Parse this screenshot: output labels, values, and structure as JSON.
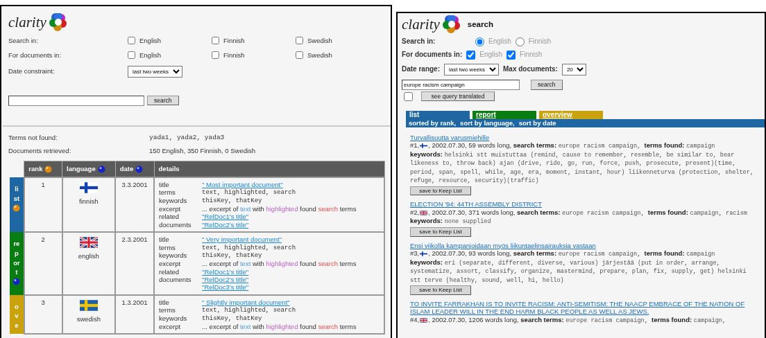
{
  "left": {
    "logo": "clarity",
    "search_in": {
      "label": "Search in:",
      "options": [
        {
          "label": "English",
          "checked": false
        },
        {
          "label": "Finnish",
          "checked": false
        },
        {
          "label": "Swedish",
          "checked": false
        }
      ]
    },
    "for_documents_in": {
      "label": "For documents in:",
      "options": [
        {
          "label": "English",
          "checked": false
        },
        {
          "label": "Finnish",
          "checked": false
        },
        {
          "label": "Swedish",
          "checked": false
        }
      ]
    },
    "date_constraint": {
      "label": "Date constraint:",
      "value": "last two weeks"
    },
    "search_button": "search",
    "terms_not_found": {
      "label": "Terms not found:",
      "value": "yada1, yada2, yada3"
    },
    "documents_retrieved": {
      "label": "Documents retrieved:",
      "value": "150 English, 350 Finnish, 0 Swedish"
    },
    "side_tabs": [
      {
        "label": "list",
        "color": "#1f67a3",
        "sortable": true,
        "selected": true
      },
      {
        "label": "report",
        "color": "#0a7d12",
        "sortable": true,
        "selected": false
      },
      {
        "label": "ove",
        "color": "#c9a20e",
        "sortable": false
      }
    ],
    "table": {
      "columns": [
        {
          "label": "rank",
          "sortable": true,
          "selected": true
        },
        {
          "label": "language",
          "sortable": true,
          "selected": false
        },
        {
          "label": "date",
          "sortable": true,
          "selected": false
        },
        {
          "label": "details",
          "sortable": false
        }
      ],
      "rows": [
        {
          "rank": "1",
          "kind": "fi",
          "language": "finnish",
          "date": "3.3.2001",
          "fields": [
            {
              "label": "title",
              "kind": "link",
              "values": [
                "\" Most important document\""
              ]
            },
            {
              "label": "terms",
              "kind": "mono",
              "values": [
                "text, highlighted, search"
              ]
            },
            {
              "label": "keywords",
              "kind": "mono",
              "values": [
                "thisKey, thatKey"
              ]
            },
            {
              "label": "excerpt",
              "kind": "excerpt",
              "segments": [
                {
                  "text": "... excerpt of ",
                  "kind": "plain"
                },
                {
                  "text": "text",
                  "kind": "term"
                },
                {
                  "text": " with ",
                  "kind": "plain"
                },
                {
                  "text": "highlighted",
                  "kind": "highlight"
                },
                {
                  "text": " found ",
                  "kind": "plain"
                },
                {
                  "text": "search",
                  "kind": "match"
                },
                {
                  "text": " terms",
                  "kind": "plain"
                }
              ]
            },
            {
              "label": "related documents",
              "kind": "link",
              "values": [
                "\"RelDoc1's title\"",
                "\"RelDoc2's title\""
              ]
            }
          ]
        },
        {
          "rank": "2",
          "kind": "gb",
          "language": "english",
          "date": "2.3.2001",
          "fields": [
            {
              "label": "title",
              "kind": "link",
              "values": [
                "\" Very important document\""
              ]
            },
            {
              "label": "terms",
              "kind": "mono",
              "values": [
                "text, highlighted, search"
              ]
            },
            {
              "label": "keywords",
              "kind": "mono",
              "values": [
                "thisKey, thatKey"
              ]
            },
            {
              "label": "excerpt",
              "kind": "excerpt",
              "segments": [
                {
                  "text": "... excerpt of ",
                  "kind": "plain"
                },
                {
                  "text": "text",
                  "kind": "term"
                },
                {
                  "text": " with ",
                  "kind": "plain"
                },
                {
                  "text": "highlighted",
                  "kind": "highlight"
                },
                {
                  "text": " found ",
                  "kind": "plain"
                },
                {
                  "text": "search",
                  "kind": "match"
                },
                {
                  "text": " terms",
                  "kind": "plain"
                }
              ]
            },
            {
              "label": "related documents",
              "kind": "link",
              "values": [
                "\"RelDoc1's title\"",
                "\"RelDoc2's title\"",
                "\"RelDoc3's title\""
              ]
            }
          ]
        },
        {
          "rank": "3",
          "kind": "se",
          "language": "swedish",
          "date": "1.3.2001",
          "fields": [
            {
              "label": "title",
              "kind": "link",
              "values": [
                "\" Slightly important document\""
              ]
            },
            {
              "label": "terms",
              "kind": "mono",
              "values": [
                "text, highlighted, search"
              ]
            },
            {
              "label": "keywords",
              "kind": "mono",
              "values": [
                "thisKey, thatKey"
              ]
            },
            {
              "label": "excerpt",
              "kind": "excerpt",
              "segments": [
                {
                  "text": "... excerpt of ",
                  "kind": "plain"
                },
                {
                  "text": "text",
                  "kind": "term"
                },
                {
                  "text": " with ",
                  "kind": "plain"
                },
                {
                  "text": "highlighted",
                  "kind": "highlight"
                },
                {
                  "text": " found ",
                  "kind": "plain"
                },
                {
                  "text": "search",
                  "kind": "match"
                },
                {
                  "text": " terms",
                  "kind": "plain"
                }
              ]
            }
          ]
        }
      ]
    }
  },
  "right": {
    "logo": "clarity",
    "heading": "search",
    "search_in": {
      "label": "Search in:",
      "options": [
        {
          "label": "English",
          "selected": true
        },
        {
          "label": "Finnish",
          "selected": false
        }
      ]
    },
    "for_documents_in": {
      "label": "For documents in:",
      "options": [
        {
          "label": "English",
          "checked": true
        },
        {
          "label": "Finnish",
          "checked": true
        }
      ]
    },
    "date_range": {
      "label": "Date range:",
      "value": "last two weeks"
    },
    "max_documents": {
      "label": "Max documents:",
      "value": "20"
    },
    "query": {
      "value": "europe racism campaign"
    },
    "search_button": "search",
    "translate": {
      "checked": false,
      "button": "see query translated"
    },
    "tabs": [
      {
        "label": "list",
        "color": "#1f67a3",
        "selected": true
      },
      {
        "label": "report",
        "color": "#0a7d12",
        "selected": false
      },
      {
        "label": "overview",
        "color": "#c9a20e",
        "selected": false
      }
    ],
    "sort_options": [
      "sorted by rank,",
      "sort by language,",
      "sort by date"
    ],
    "results": [
      {
        "title": "Turvallisuutta varusmiehille",
        "number": "#1,",
        "kind": "fi",
        "details": ", 2002.07.30, 59 words long,",
        "search_terms_label": "search terms:",
        "search_terms": "europe racism campaign,",
        "terms_found_label": "terms found:",
        "terms_found": "campaign",
        "keywords_label": "keywords:",
        "keywords": "helsinki stt muistuttaa (remind, cause to remember, resemble, be similar to, bear likeness to, throw back) ajan (drive, ride, go, run, force, push, prosecute, present)(time, period, span, spell, while, age, era, moment, instant, hour) liikenneturva (protection, shelter, refuge, resource, security)(traffic)",
        "button": "save to Keep List"
      },
      {
        "title": "ELECTION '94: 44TH ASSEMBLY DISTRICT",
        "number": "#2,",
        "kind": "gb",
        "details": ", 2002.07.30, 371 words long,",
        "search_terms_label": "search terms:",
        "search_terms": "europe racism campaign,",
        "terms_found_label": "terms found:",
        "terms_found": "campaign, racism",
        "keywords_label": "keywords:",
        "keywords": "none supplied",
        "button": "save to Keep List"
      },
      {
        "title": "Ensi viikolla kampanjoidaan myös liikuntaelinsairauksia vastaan",
        "number": "#3,",
        "kind": "fi",
        "details": ", 2002.07.30, 93 words long,",
        "search_terms_label": "search terms:",
        "search_terms": "europe racism campaign,",
        "terms_found_label": "terms found:",
        "terms_found": "campaign",
        "keywords_label": "keywords:",
        "keywords": "eri (separate, different, diverse, various) järjestää (put in order, arrange, systematize, assort, classify, organize, mastermind, prepare, plan, fix, supply, get) helsinki stt terve (healthy, sound, well, hi, hello)",
        "button": "save to Keep List"
      },
      {
        "title": "TO INVITE FARRAKHAN IS TO INVITE RACISM: ANTI-SEMITISM: THE NAACP EMBRACE OF THE NATION OF ISLAM LEADER WILL IN THE END HARM BLACK PEOPLE AS WELL AS JEWS.",
        "number": "#4,",
        "kind": "gb",
        "details": ", 2002.07.30, 1206 words long,",
        "search_terms_label": "search terms:",
        "search_terms": "europe racism campaign,",
        "terms_found_label": "terms found:",
        "terms_found": "campaign,"
      }
    ]
  }
}
